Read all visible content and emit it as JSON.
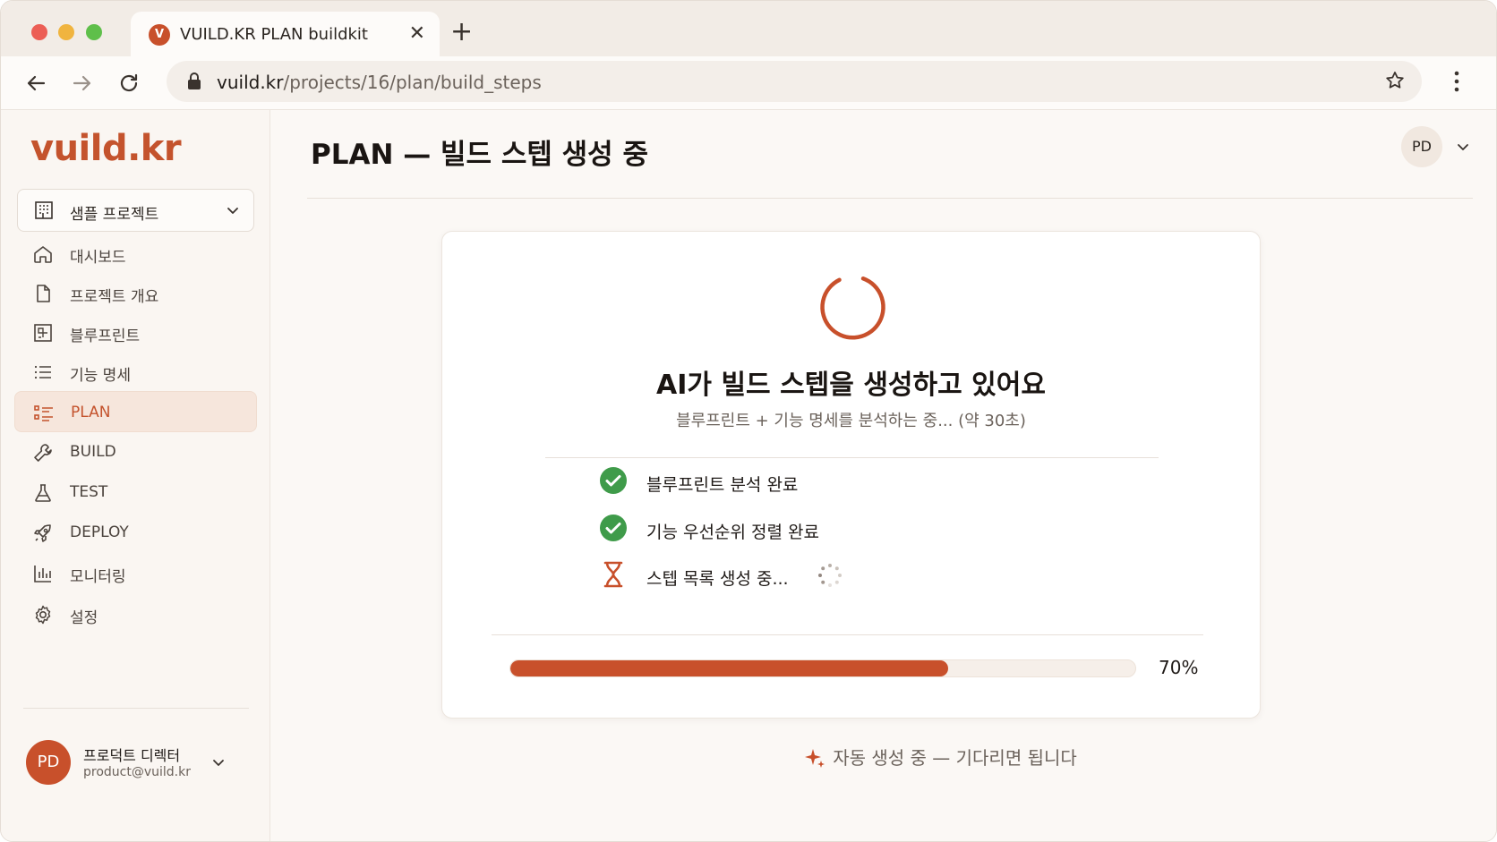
{
  "browser": {
    "tab_title": "VUILD.KR PLAN buildkit",
    "tab_favicon": "V",
    "url_host": "vuild.kr",
    "url_path": "/projects/16/plan/build_steps"
  },
  "sidebar": {
    "logo": "vuild.kr",
    "project_selector": "샘플 프로젝트",
    "items": [
      {
        "label": "대시보드",
        "icon": "home-icon"
      },
      {
        "label": "프로젝트 개요",
        "icon": "document-icon"
      },
      {
        "label": "블루프린트",
        "icon": "blueprint-icon"
      },
      {
        "label": "기능 명세",
        "icon": "list-icon"
      },
      {
        "label": "PLAN",
        "icon": "plan-list-icon",
        "active": true
      },
      {
        "label": "BUILD",
        "icon": "wrench-icon"
      },
      {
        "label": "TEST",
        "icon": "flask-icon"
      },
      {
        "label": "DEPLOY",
        "icon": "rocket-icon"
      },
      {
        "label": "모니터링",
        "icon": "bar-chart-icon"
      },
      {
        "label": "설정",
        "icon": "gear-icon"
      }
    ],
    "user": {
      "initials": "PD",
      "name": "프로덕트 디렉터",
      "email": "product@vuild.kr"
    }
  },
  "header": {
    "title": "PLAN — 빌드 스텝 생성 중",
    "avatar_initials": "PD"
  },
  "card": {
    "title": "AI가 빌드 스텝을 생성하고 있어요",
    "subtitle": "블루프린트 + 기능 명세를 분석하는 중... (약 30초)",
    "steps": [
      {
        "label": "블루프린트 분석 완료",
        "status": "done"
      },
      {
        "label": "기능 우선순위 정렬 완료",
        "status": "done"
      },
      {
        "label": "스텝 목록 생성 중...",
        "status": "in-progress"
      }
    ],
    "progress_value": 0.7,
    "progress_label": "70%"
  },
  "footer_note": "자동 생성 중 — 기다리면 됩니다",
  "colors": {
    "accent": "#c8502b",
    "success": "#3f9b4a",
    "background": "#fbf8f5"
  }
}
